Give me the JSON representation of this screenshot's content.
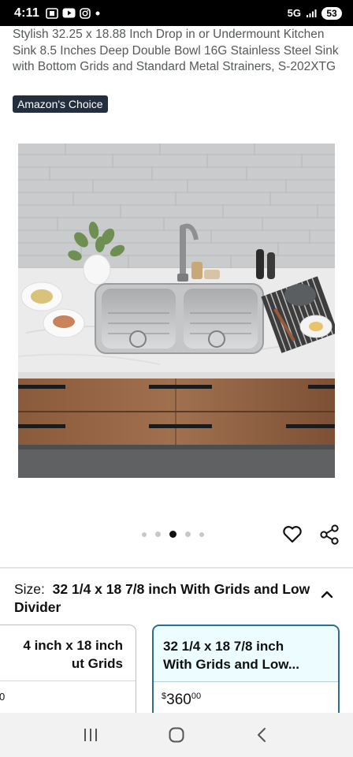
{
  "status_bar": {
    "time": "4:11",
    "network": "5G",
    "battery": "53",
    "icons": [
      "screen-record-icon",
      "youtube-icon",
      "instagram-icon",
      "dot-icon",
      "signal-icon"
    ]
  },
  "product": {
    "title": "Stylish 32.25 x 18.88 Inch Drop in or Undermount Kitchen Sink 8.5 Inches Deep Double Bowl 16G Stainless Steel Sink with Bottom Grids and Standard Metal Strainers, S-202XTG",
    "badge": "Amazon's Choice",
    "image_description_icon": "kitchen-sink-photo"
  },
  "carousel": {
    "dot_count": 5,
    "active_index": 2,
    "actions": {
      "favorite_icon": "heart-icon",
      "share_icon": "share-icon"
    }
  },
  "size_selector": {
    "label": "Size:",
    "selected_value": "32 1/4 x 18 7/8 inch With Grids and Low Divider",
    "toggle_icon": "chevron-up-icon",
    "options": [
      {
        "title": "4 inch x 18 inch ut Grids",
        "title_line1": "4 inch x 18 inch",
        "title_line2": "ut Grids",
        "price_text": "0"
      },
      {
        "title_line1": "32 1/4 x 18 7/8 inch",
        "title_line2": "With Grids and Low...",
        "price_currency": "$",
        "price_whole": "360",
        "price_fraction": "00",
        "selected": true
      }
    ]
  },
  "nav_bar": {
    "buttons": [
      "recent-apps-icon",
      "home-icon",
      "back-icon"
    ]
  },
  "colors": {
    "badge_bg": "#232f3e",
    "selected_border": "#2b6f8f",
    "selected_bg": "#edfdff"
  }
}
